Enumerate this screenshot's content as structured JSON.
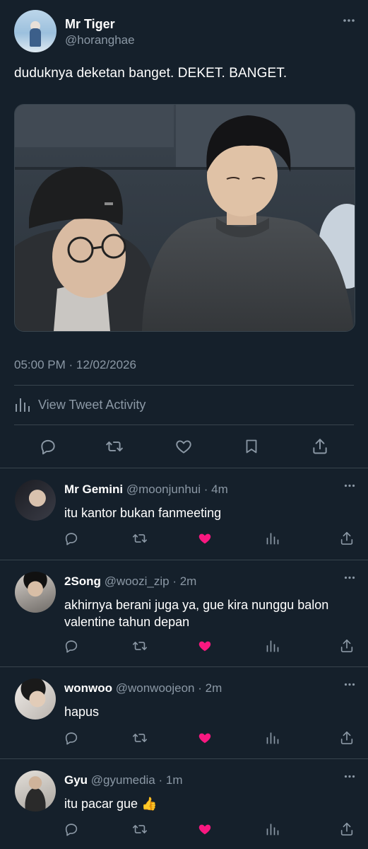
{
  "tweet": {
    "display_name": "Mr Tiger",
    "handle": "@horanghae",
    "text": "duduknya deketan banget. DEKET. BANGET.",
    "timestamp": "05:00 PM · 12/02/2026",
    "activity_label": "View Tweet Activity"
  },
  "icons": {
    "more": "more-horizontal-icon",
    "reply": "reply-icon",
    "retweet": "retweet-icon",
    "like": "heart-icon",
    "bookmark": "bookmark-icon",
    "share": "share-icon",
    "activity": "bar-chart-icon"
  },
  "colors": {
    "background": "#15202b",
    "muted": "#8b98a5",
    "divider": "#38444d",
    "like_active": "#f91880"
  },
  "replies": [
    {
      "name": "Mr Gemini",
      "handle": "@moonjunhui",
      "time": "4m",
      "text": "itu kantor bukan fanmeeting",
      "liked": true
    },
    {
      "name": "2Song",
      "handle": "@woozi_zip",
      "time": "2m",
      "text": "akhirnya berani juga ya, gue kira nunggu balon valentine tahun depan",
      "liked": true
    },
    {
      "name": "wonwoo",
      "handle": "@wonwoojeon",
      "time": "2m",
      "text": "hapus",
      "liked": true
    },
    {
      "name": "Gyu",
      "handle": "@gyumedia",
      "time": "1m",
      "text": "itu pacar gue 👍",
      "liked": true
    }
  ]
}
